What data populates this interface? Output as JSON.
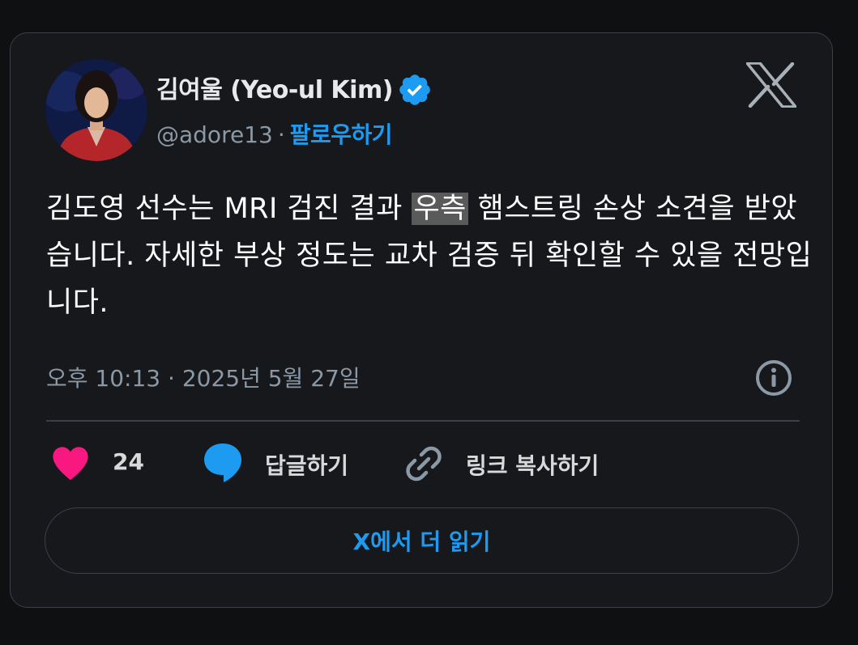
{
  "author": {
    "name": "김여울 (Yeo-ul Kim)",
    "handle": "@adore13",
    "separator": "·",
    "follow_label": "팔로우하기"
  },
  "tweet": {
    "text_before": "김도영 선수는 MRI 검진 결과 ",
    "text_highlight": "우측",
    "text_after": " 햄스트링 손상 소견을 받았습니다. 자세한 부상 정도는 교차 검증 뒤 확인할 수 있을 전망입니다.",
    "timestamp": "오후 10:13 · 2025년 5월 27일"
  },
  "actions": {
    "like_count": "24",
    "reply_label": "답글하기",
    "copy_link_label": "링크 복사하기"
  },
  "read_more_label": "X에서 더 읽기",
  "icons": {
    "verified": "verified-badge-icon",
    "brand": "x-logo-icon",
    "info": "info-icon",
    "like": "heart-icon",
    "reply": "speech-bubble-icon",
    "link": "link-icon"
  },
  "colors": {
    "accent": "#1d9bf0",
    "like": "#f91880",
    "background": "#16181c",
    "text": "#ffffff",
    "muted": "#8b98a5"
  }
}
